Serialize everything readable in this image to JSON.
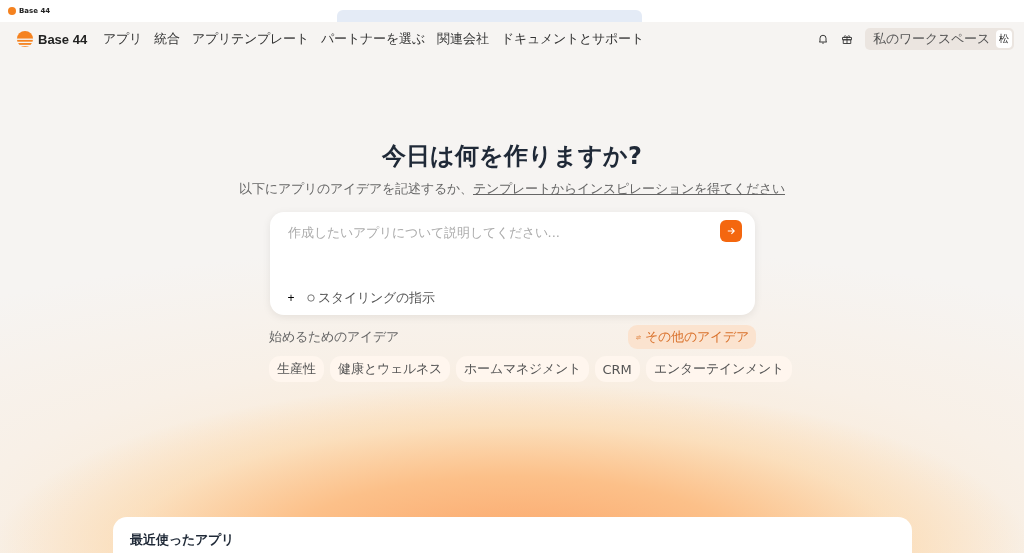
{
  "browser_tab": {
    "title": "Base 44"
  },
  "nav": {
    "logo": "Base 44",
    "items": [
      "アプリ",
      "統合",
      "アプリテンプレート",
      "パートナーを選ぶ",
      "関連会社",
      "ドキュメントとサポート"
    ],
    "workspace": "私のワークスペース",
    "avatar": "松"
  },
  "hero": {
    "title": "今日は何を作りますか?",
    "subtitle": "以下にアプリのアイデアを記述するか、",
    "subtitle_link": "テンプレートからインスピレーションを得てください"
  },
  "prompt": {
    "placeholder": "作成したいアプリについて説明してください...",
    "add": "+",
    "styling": "スタイリングの指示"
  },
  "ideas": {
    "label": "始めるためのアイデア",
    "more": "その他のアイデア",
    "chips": [
      "生産性",
      "健康とウェルネス",
      "ホームマネジメント",
      "CRM",
      "エンターテインメント"
    ]
  },
  "recent": {
    "title": "最近使ったアプリ"
  }
}
